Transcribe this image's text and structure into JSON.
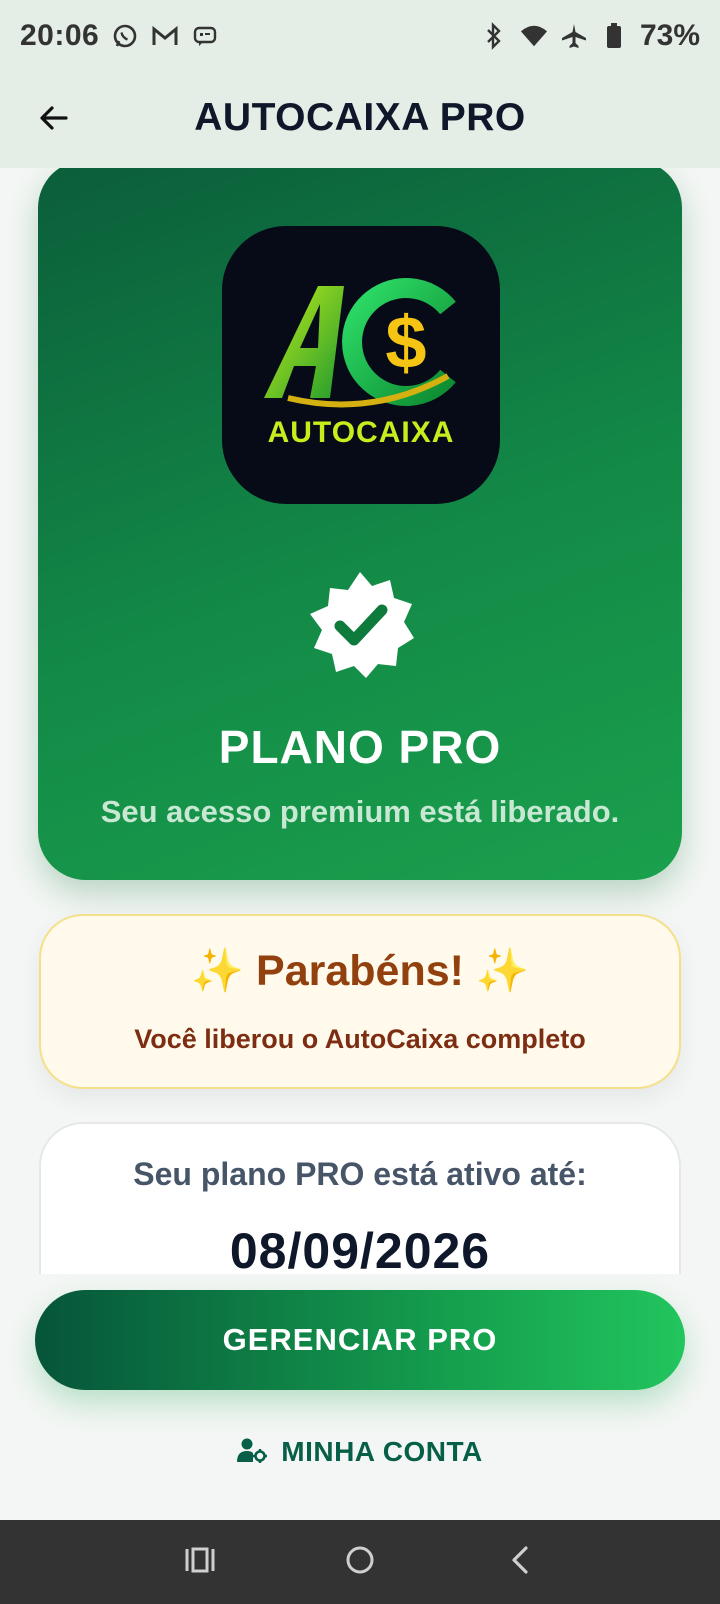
{
  "status_bar": {
    "time": "20:06",
    "battery_percent": "73%",
    "notification_icons": [
      "whatsapp-icon",
      "gmail-icon",
      "message-icon"
    ],
    "system_icons": [
      "bluetooth-icon",
      "wifi-icon",
      "airplane-icon",
      "battery-icon"
    ]
  },
  "app_bar": {
    "title": "AUTOCAIXA PRO",
    "back_icon": "arrow-left-icon"
  },
  "hero": {
    "logo_text": "AUTOCAIXA",
    "badge_icon": "verified-badge-icon",
    "plan_title": "PLANO PRO",
    "plan_subtitle": "Seu acesso premium está liberado."
  },
  "congrats": {
    "title": "✨ Parabéns! ✨",
    "subtitle": "Você liberou o AutoCaixa completo"
  },
  "active_plan": {
    "label": "Seu plano PRO está ativo até:",
    "date": "08/09/2026"
  },
  "actions": {
    "manage_label": "GERENCIAR PRO",
    "account_label": "MINHA CONTA",
    "account_icon": "user-gear-icon"
  },
  "colors": {
    "accent": "#16a34a",
    "hero_dark": "#0b5d3a",
    "congrats_bg": "#fffaeb",
    "congrats_text": "#92400e"
  },
  "nav_bar": {
    "icons": [
      "recents-icon",
      "home-icon",
      "back-icon"
    ]
  }
}
